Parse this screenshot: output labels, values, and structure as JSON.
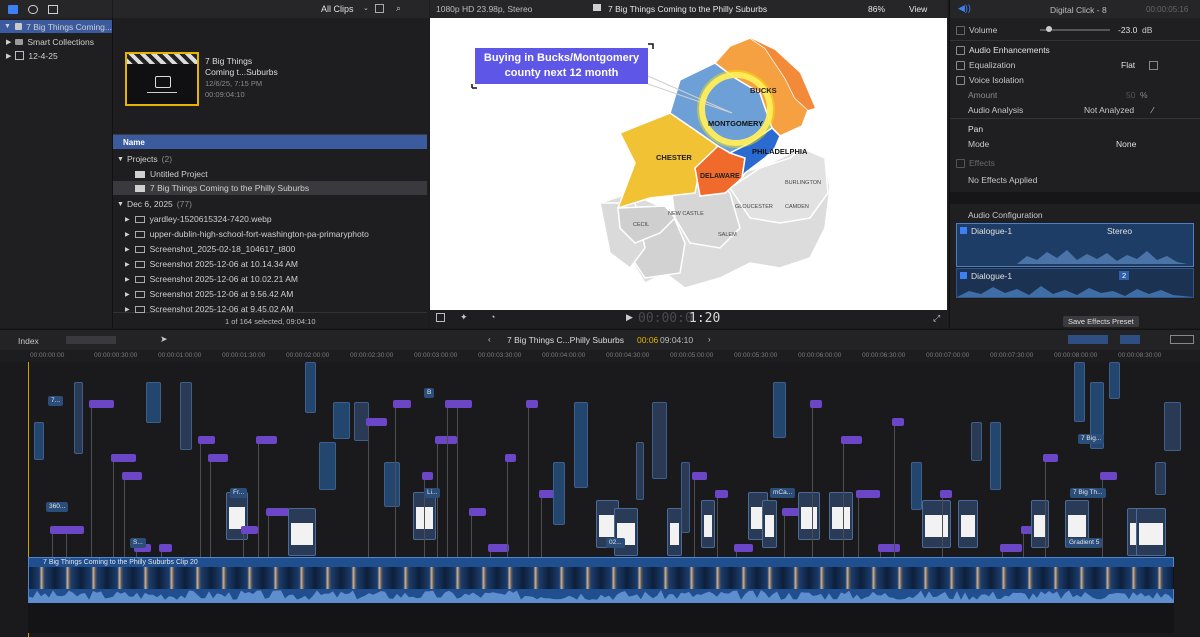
{
  "toolbar": {
    "clips_filter": "All Clips",
    "viewer_format": "1080p HD 23.98p, Stereo",
    "viewer_title": "7 Big Things Coming to the Philly Suburbs",
    "zoom": "86%",
    "view_label": "View",
    "inspector_title": "Digital Click - 8",
    "inspector_time": "00:00:05:16"
  },
  "library": {
    "name": "7 Big Things Coming...",
    "items": [
      "Smart Collections",
      "12-4-25"
    ]
  },
  "browser": {
    "preview_title_line1": "7 Big Things",
    "preview_title_line2": "Coming t...Suburbs",
    "preview_date": "12/6/25, 7:15 PM",
    "preview_duration": "00:09:04:10",
    "column_name": "Name",
    "group_projects": "Projects",
    "group_projects_count": "(2)",
    "projects": [
      "Untitled Project",
      "7 Big Things Coming to the Philly Suburbs"
    ],
    "group_date": "Dec 6, 2025",
    "group_date_count": "(77)",
    "files": [
      "yardley-1520615324-7420.webp",
      "upper-dublin-high-school-fort-washington-pa-primaryphoto",
      "Screenshot_2025-02-18_104617_t800",
      "Screenshot 2025-12-06 at 10.14.34 AM",
      "Screenshot 2025-12-06 at 10.02.21 AM",
      "Screenshot 2025-12-06 at 9.56.42 AM",
      "Screenshot 2025-12-06 at 9.45.02 AM"
    ],
    "selection_status": "1 of 164 selected, 09:04:10"
  },
  "viewer": {
    "callout_line1": "Buying in Bucks/Montgomery",
    "callout_line2": "county next 12 month",
    "timecode_dim": "00:00:0",
    "timecode_bright": "1:20",
    "map_labels": {
      "bucks": "BUCKS",
      "montgomery": "MONTGOMERY",
      "chester": "CHESTER",
      "philadelphia": "PHILADELPHIA",
      "delaware": "DELAWARE",
      "burlington": "BURLINGTON",
      "gloucester": "GLOUCESTER",
      "camden": "CAMDEN",
      "new_castle": "NEW CASTLE",
      "cecil": "CECIL",
      "salem": "SALEM"
    }
  },
  "inspector": {
    "volume_label": "Volume",
    "volume_value": "-23.0",
    "volume_unit": "dB",
    "audio_enhancements": "Audio Enhancements",
    "equalization_label": "Equalization",
    "equalization_value": "Flat",
    "voice_isolation": "Voice Isolation",
    "amount_label": "Amount",
    "amount_value": "50",
    "amount_unit": "%",
    "audio_analysis_label": "Audio Analysis",
    "audio_analysis_value": "Not Analyzed",
    "pan_label": "Pan",
    "mode_label": "Mode",
    "mode_value": "None",
    "effects_label": "Effects",
    "effects_value": "No Effects Applied",
    "audio_configuration": "Audio Configuration",
    "config_rows": [
      {
        "name": "Dialogue-1",
        "channel": "Stereo"
      },
      {
        "name": "Dialogue-1",
        "channel": "2"
      }
    ],
    "save_preset": "Save Effects Preset"
  },
  "timeline": {
    "index_label": "Index",
    "project_name": "7 Big Things C...Philly Suburbs",
    "position": "00:06",
    "duration": "09:04:10",
    "ruler_ticks": [
      "00:00:00:00",
      "00:00:00:30:00",
      "00:00:01:00:00",
      "00:00:01:30:00",
      "00:00:02:00:00",
      "00:00:02:30:00",
      "00:00:03:00:00",
      "00:00:03:30:00",
      "00:00:04:00:00",
      "00:00:04:30:00",
      "00:00:05:00:00",
      "00:00:05:30:00",
      "00:00:06:00:00",
      "00:00:06:30:00",
      "00:00:07:00:00",
      "00:00:07:30:00",
      "00:00:08:00:00",
      "00:00:08:30:00"
    ],
    "primary_clip": "7 Big Things Coming to the Philly Suburbs Clip 20",
    "clip_labels": [
      "7...",
      "360...",
      "7 Big...",
      "7 Big Th...",
      "Gradient 5",
      "mCa...",
      "02...",
      "Fr...",
      "S...",
      "Li...",
      "B"
    ]
  }
}
